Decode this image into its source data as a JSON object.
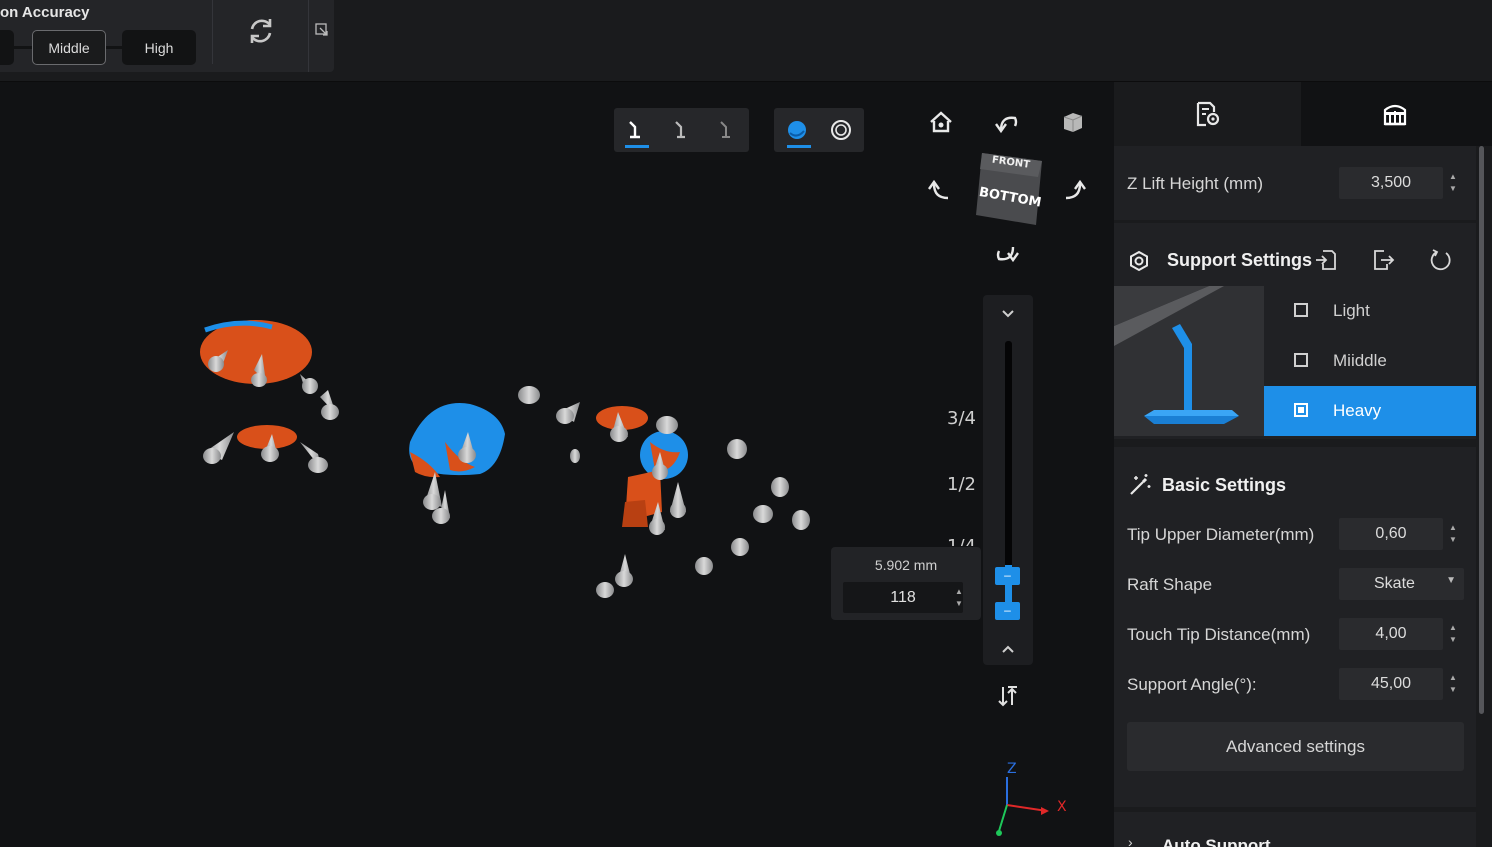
{
  "accuracy": {
    "title": "on Accuracy",
    "options": [
      "Middle",
      "High"
    ]
  },
  "viewport": {
    "layer_height": "5.902 mm",
    "layer_index": "118",
    "slider_ticks": [
      "3/4",
      "1/2",
      "1/4"
    ],
    "cube_faces": {
      "front": "FRONT",
      "bottom": "BOTTOM"
    },
    "axes": {
      "z": "Z",
      "x": "X"
    },
    "accent": "#1e8fe8"
  },
  "panel": {
    "z_lift": {
      "label": "Z Lift Height (mm)",
      "value": "3,500"
    },
    "support_settings": {
      "title": "Support Settings",
      "options": [
        {
          "label": "Light",
          "checked": false
        },
        {
          "label": "Miiddle",
          "checked": false
        },
        {
          "label": "Heavy",
          "checked": true
        }
      ]
    },
    "basic_settings": {
      "title": "Basic Settings",
      "tip_upper_diameter": {
        "label": "Tip Upper Diameter(mm)",
        "value": "0,60"
      },
      "raft_shape": {
        "label": "Raft Shape",
        "value": "Skate"
      },
      "touch_tip_distance": {
        "label": "Touch Tip Distance(mm)",
        "value": "4,00"
      },
      "support_angle": {
        "label": "Support Angle(°):",
        "value": "45,00"
      },
      "advanced_button": "Advanced settings"
    },
    "auto_support": {
      "title": "Auto Support"
    }
  }
}
